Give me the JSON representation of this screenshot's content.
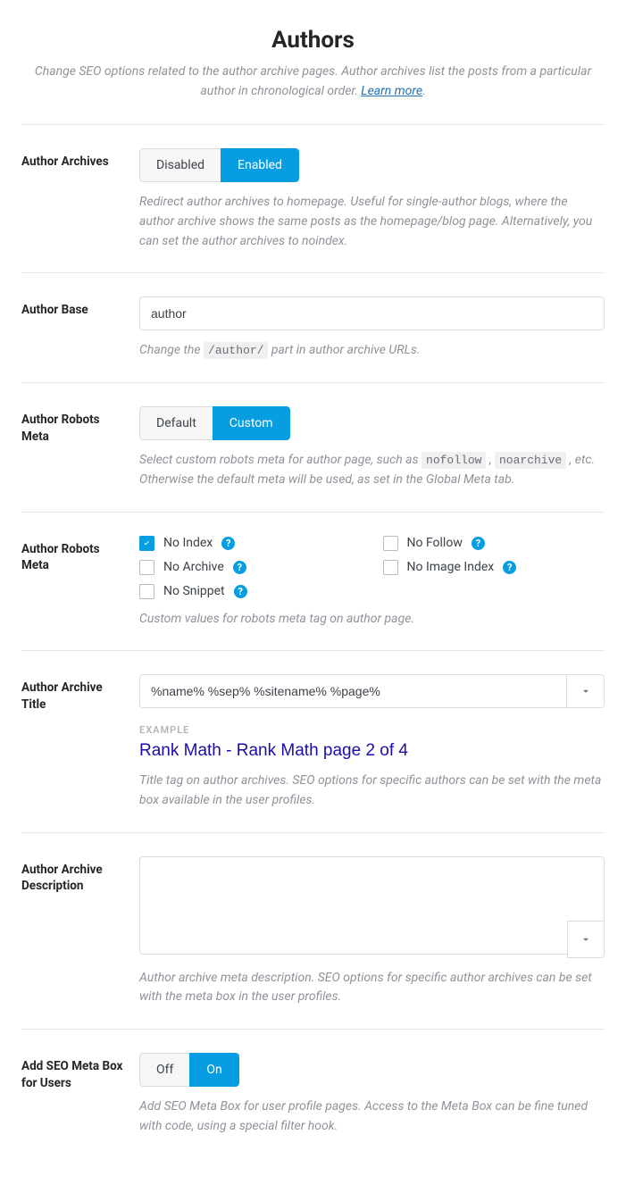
{
  "page": {
    "title": "Authors",
    "description_pre": "Change SEO options related to the author archive pages. Author archives list the posts from a particular author in chronological order. ",
    "learn_more": "Learn more",
    "description_post": "."
  },
  "archives": {
    "label": "Author Archives",
    "options": {
      "off": "Disabled",
      "on": "Enabled"
    },
    "help": "Redirect author archives to homepage. Useful for single-author blogs, where the author archive shows the same posts as the homepage/blog page. Alternatively, you can set the author archives to noindex."
  },
  "base": {
    "label": "Author Base",
    "value": "author",
    "help_pre": "Change the ",
    "help_code": "/author/",
    "help_post": " part in author archive URLs."
  },
  "robots_mode": {
    "label": "Author Robots Meta",
    "options": {
      "off": "Default",
      "on": "Custom"
    },
    "help_pre": "Select custom robots meta for author page, such as ",
    "help_code1": "nofollow",
    "help_mid": " , ",
    "help_code2": "noarchive",
    "help_post": " , etc. Otherwise the default meta will be used, as set in the Global Meta tab."
  },
  "robots_meta": {
    "label": "Author Robots Meta",
    "items": [
      {
        "label": "No Index",
        "checked": true
      },
      {
        "label": "No Follow",
        "checked": false
      },
      {
        "label": "No Archive",
        "checked": false
      },
      {
        "label": "No Image Index",
        "checked": false
      },
      {
        "label": "No Snippet",
        "checked": false
      }
    ],
    "help": "Custom values for robots meta tag on author page."
  },
  "archive_title": {
    "label": "Author Archive Title",
    "value": "%name% %sep% %sitename% %page%",
    "example_label": "EXAMPLE",
    "example_preview": "Rank Math - Rank Math page 2 of 4",
    "help": "Title tag on author archives. SEO options for specific authors can be set with the meta box available in the user profiles."
  },
  "archive_desc": {
    "label": "Author Archive Description",
    "value": "",
    "help": "Author archive meta description. SEO options for specific author archives can be set with the meta box in the user profiles."
  },
  "seo_box": {
    "label": "Add SEO Meta Box for Users",
    "options": {
      "off": "Off",
      "on": "On"
    },
    "help": "Add SEO Meta Box for user profile pages. Access to the Meta Box can be fine tuned with code, using a special filter hook."
  }
}
